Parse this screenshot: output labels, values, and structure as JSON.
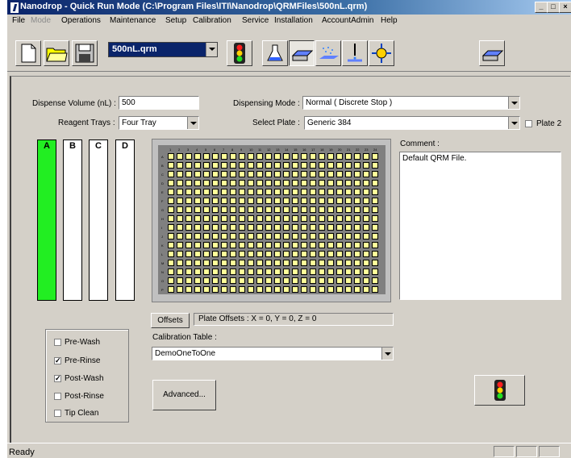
{
  "window": {
    "title": "Nanodrop - Quick Run Mode (C:\\Program Files\\ITI\\Nanodrop\\QRMFiles\\500nL.qrm)",
    "min_label": "_",
    "max_label": "□",
    "close_label": "×"
  },
  "menu": [
    "File",
    "Mode",
    "Operations",
    "Maintenance",
    "Setup",
    "Calibration",
    "Service",
    "Installation",
    "AccountAdmin",
    "Help"
  ],
  "toolbar": {
    "file_combo": "500nL.qrm",
    "icons": [
      "new-file-icon",
      "open-folder-icon",
      "save-disk-icon",
      "traffic-light-icon",
      "flask-icon",
      "plate-icon",
      "spray-icon",
      "dispense-icon",
      "target-icon",
      "plate-tray-icon"
    ]
  },
  "form": {
    "dispense_volume_label": "Dispense Volume (nL) :",
    "dispense_volume_value": "500",
    "reagent_trays_label": "Reagent Trays :",
    "reagent_trays_value": "Four Tray",
    "dispensing_mode_label": "Dispensing Mode :",
    "dispensing_mode_value": "Normal ( Discrete Stop )",
    "select_plate_label": "Select Plate :",
    "select_plate_value": "Generic 384",
    "plate2_label": "Plate 2",
    "comment_label": "Comment :",
    "comment_value": "Default QRM File."
  },
  "trays": [
    {
      "label": "A",
      "active": true
    },
    {
      "label": "B",
      "active": false
    },
    {
      "label": "C",
      "active": false
    },
    {
      "label": "D",
      "active": false
    }
  ],
  "plate": {
    "columns": 24,
    "rows": 16,
    "col_labels": [
      "1",
      "2",
      "3",
      "4",
      "5",
      "6",
      "7",
      "8",
      "9",
      "10",
      "11",
      "12",
      "13",
      "14",
      "15",
      "16",
      "17",
      "18",
      "19",
      "20",
      "21",
      "22",
      "23",
      "24"
    ],
    "row_labels": [
      "A",
      "B",
      "C",
      "D",
      "E",
      "F",
      "G",
      "H",
      "I",
      "J",
      "K",
      "L",
      "M",
      "N",
      "O",
      "P"
    ],
    "well_color": "#ffff99"
  },
  "offsets": {
    "button_label": "Offsets",
    "text": "Plate Offsets : X = 0, Y = 0, Z = 0"
  },
  "calibration": {
    "label": "Calibration Table :",
    "value": "DemoOneToOne"
  },
  "advanced_label": "Advanced...",
  "options": [
    {
      "label": "Pre-Wash",
      "checked": false
    },
    {
      "label": "Pre-Rinse",
      "checked": true
    },
    {
      "label": "Post-Wash",
      "checked": true
    },
    {
      "label": "Post-Rinse",
      "checked": false
    },
    {
      "label": "Tip Clean",
      "checked": false
    }
  ],
  "status": {
    "text": "Ready"
  },
  "colors": {
    "title_bar": "#0a246a",
    "tray_active": "#22ee22",
    "window_bg": "#d4d0c8"
  }
}
